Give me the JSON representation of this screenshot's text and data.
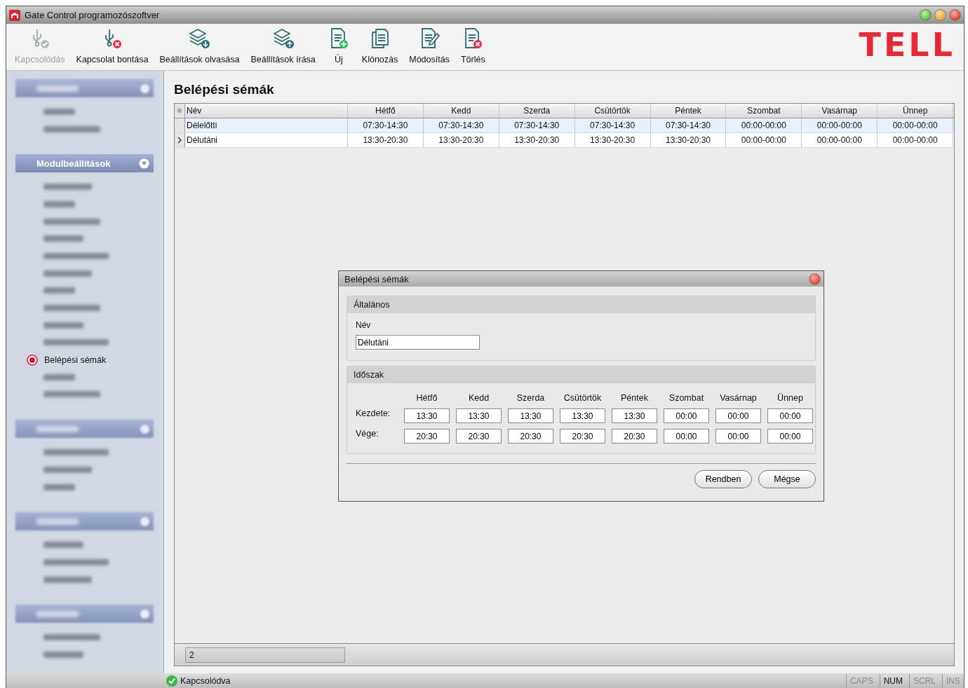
{
  "window": {
    "title": "Gate Control programozószoftver"
  },
  "toolbar": [
    {
      "label": "Kapcsolódás",
      "kind": "usb-check",
      "disabled": true
    },
    {
      "label": "Kapcsolat bontása",
      "kind": "usb-x",
      "disabled": false
    },
    {
      "label": "Beállítások olvasása",
      "kind": "layers-down",
      "disabled": false
    },
    {
      "label": "Beállítások írása",
      "kind": "layers-up",
      "disabled": false
    },
    {
      "label": "Új",
      "kind": "doc-plus",
      "disabled": false
    },
    {
      "label": "Klónozás",
      "kind": "docs",
      "disabled": false
    },
    {
      "label": "Módosítás",
      "kind": "doc-pen",
      "disabled": false
    },
    {
      "label": "Törlés",
      "kind": "doc-x",
      "disabled": false
    }
  ],
  "logo": {
    "text": "TELL"
  },
  "sidebar": {
    "sections": [
      {
        "header": {
          "kind": "blurred"
        },
        "items": [
          {
            "kind": "blurred"
          },
          {
            "kind": "blurred"
          }
        ]
      },
      {
        "header": {
          "kind": "text",
          "label": "Modulbeállítások",
          "expanded": true
        },
        "items": [
          {
            "kind": "blurred"
          },
          {
            "kind": "blurred"
          },
          {
            "kind": "blurred"
          },
          {
            "kind": "blurred"
          },
          {
            "kind": "blurred"
          },
          {
            "kind": "blurred"
          },
          {
            "kind": "blurred"
          },
          {
            "kind": "blurred"
          },
          {
            "kind": "blurred"
          },
          {
            "kind": "blurred"
          },
          {
            "kind": "text",
            "label": "Belépési sémák",
            "selected": true
          },
          {
            "kind": "blurred"
          },
          {
            "kind": "blurred"
          }
        ]
      },
      {
        "header": {
          "kind": "blurred"
        },
        "items": [
          {
            "kind": "blurred"
          },
          {
            "kind": "blurred"
          },
          {
            "kind": "blurred"
          }
        ]
      },
      {
        "header": {
          "kind": "blurred"
        },
        "items": [
          {
            "kind": "blurred"
          },
          {
            "kind": "blurred"
          },
          {
            "kind": "blurred"
          }
        ]
      },
      {
        "header": {
          "kind": "blurred"
        },
        "items": [
          {
            "kind": "blurred"
          },
          {
            "kind": "blurred"
          }
        ]
      }
    ]
  },
  "page": {
    "title": "Belépési sémák"
  },
  "table": {
    "columns": [
      "Név",
      "Hétfő",
      "Kedd",
      "Szerda",
      "Csütörtök",
      "Péntek",
      "Szombat",
      "Vasárnap",
      "Ünnep"
    ],
    "rows": [
      {
        "selected": true,
        "current": false,
        "cells": [
          "Délelőtti",
          "07:30-14:30",
          "07:30-14:30",
          "07:30-14:30",
          "07:30-14:30",
          "07:30-14:30",
          "00:00-00:00",
          "00:00-00:00",
          "00:00-00:00"
        ]
      },
      {
        "selected": false,
        "current": true,
        "cells": [
          "Délutáni",
          "13:30-20:30",
          "13:30-20:30",
          "13:30-20:30",
          "13:30-20:30",
          "13:30-20:30",
          "00:00-00:00",
          "00:00-00:00",
          "00:00-00:00"
        ]
      }
    ]
  },
  "pager": {
    "value": "2"
  },
  "dialog": {
    "title": "Belépési sémák",
    "general": {
      "title": "Általános",
      "name_label": "Név",
      "name_value": "Délutáni"
    },
    "period": {
      "title": "Időszak",
      "days": [
        "Hétfő",
        "Kedd",
        "Szerda",
        "Csütörtök",
        "Péntek",
        "Szombat",
        "Vasárnap",
        "Ünnep"
      ],
      "rows": [
        {
          "label": "Kezdete:",
          "values": [
            "13:30",
            "13:30",
            "13:30",
            "13:30",
            "13:30",
            "00:00",
            "00:00",
            "00:00"
          ]
        },
        {
          "label": "Vége:",
          "values": [
            "20:30",
            "20:30",
            "20:30",
            "20:30",
            "20:30",
            "00:00",
            "00:00",
            "00:00"
          ]
        }
      ]
    },
    "buttons": [
      "Rendben",
      "Mégse"
    ]
  },
  "status_bar": {
    "text": "Kapcsolódva",
    "indicators": [
      {
        "label": "CAPS",
        "on": false
      },
      {
        "label": "NUM",
        "on": true
      },
      {
        "label": "SCRL",
        "on": false
      },
      {
        "label": "INS",
        "on": false
      }
    ]
  }
}
